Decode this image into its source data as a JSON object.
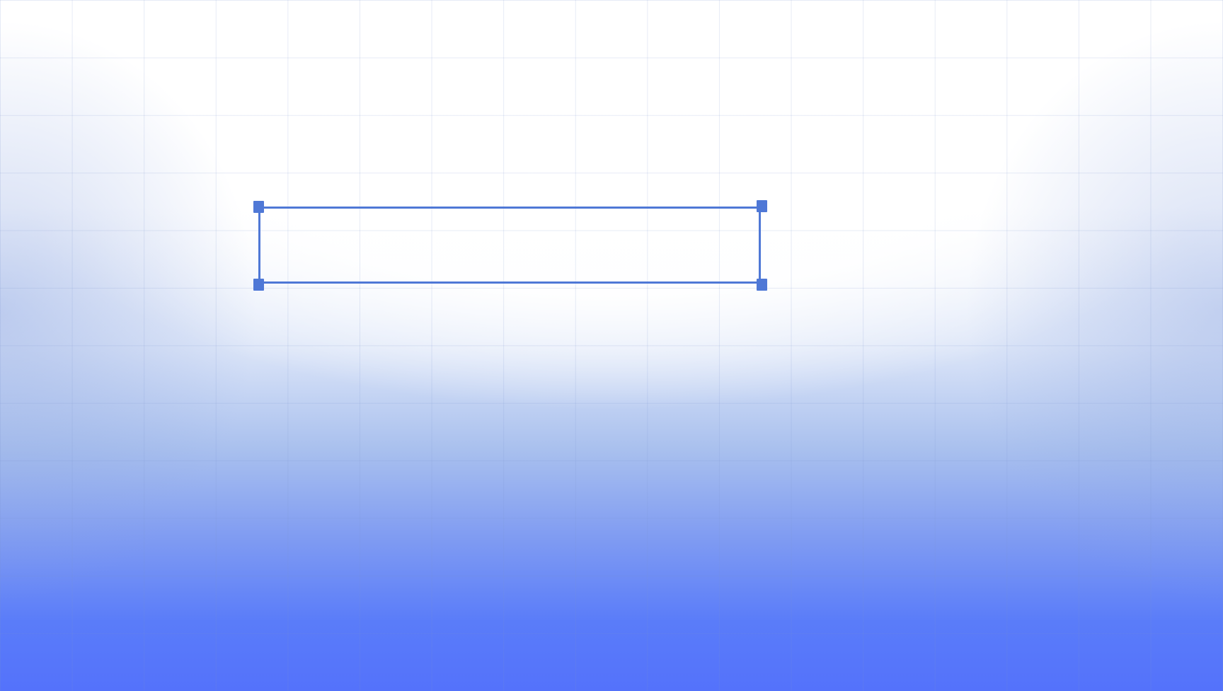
{
  "canvas": {
    "background_top_color": "#ffffff",
    "background_bottom_color": "#5472fb",
    "grid_visible": true,
    "grid_color": "#c8d3ec"
  },
  "selection": {
    "shape": "rectangle",
    "stroke_color": "#4f78d6",
    "handle_color": "#4f78d6",
    "handles": [
      "top-left",
      "top-right",
      "bottom-left",
      "bottom-right"
    ],
    "label": ""
  }
}
